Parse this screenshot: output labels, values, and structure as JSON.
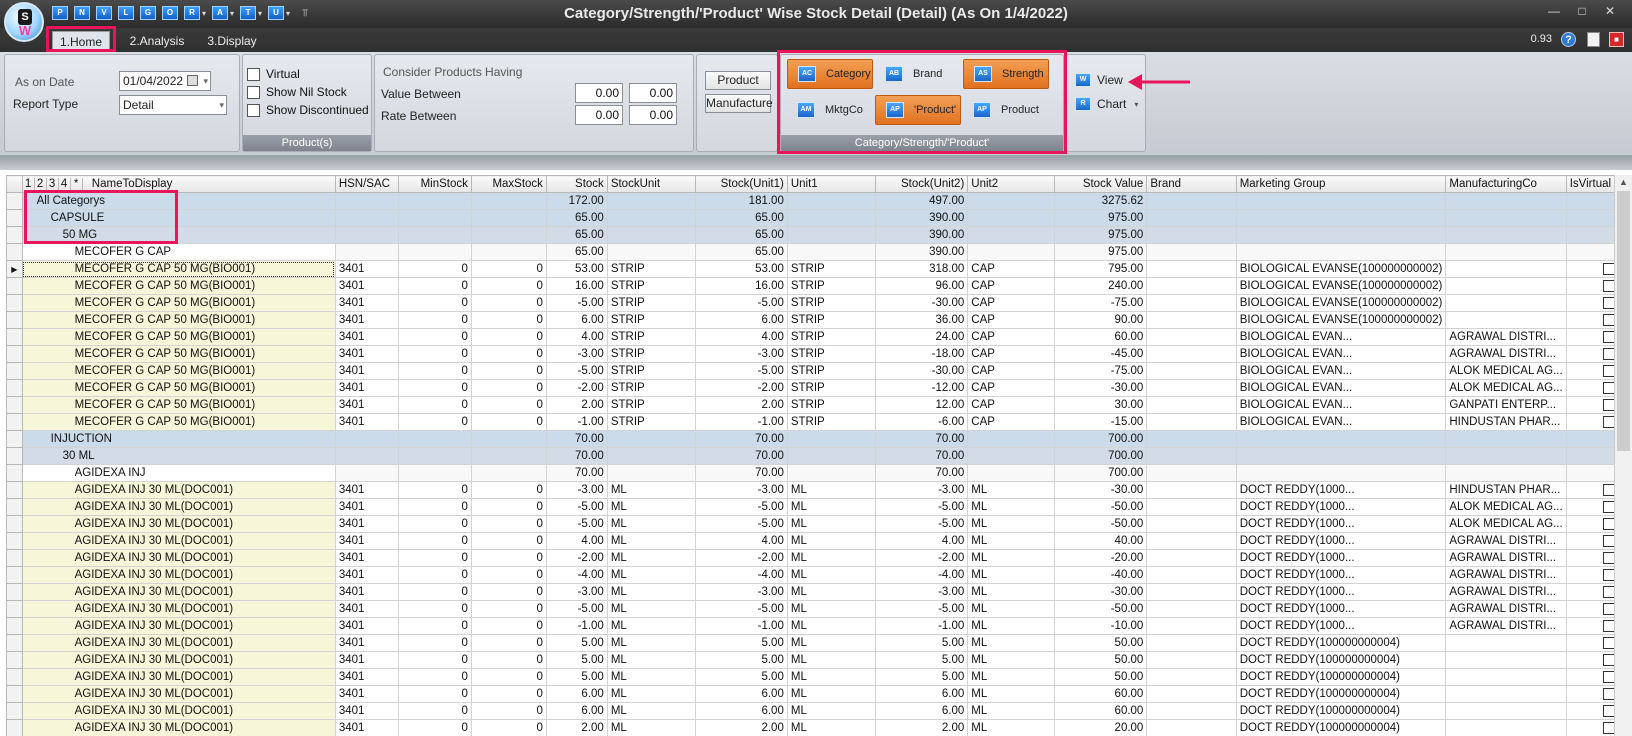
{
  "window": {
    "title": "Category/Strength/'Product' Wise Stock Detail (Detail)  (As On 1/4/2022)",
    "zoom": "0.93"
  },
  "quick_access": [
    {
      "icon": "P"
    },
    {
      "icon": "N"
    },
    {
      "icon": "V"
    },
    {
      "icon": "L"
    },
    {
      "icon": "G"
    },
    {
      "icon": "O"
    },
    {
      "icon": "R"
    },
    {
      "icon": "A"
    },
    {
      "icon": "T"
    },
    {
      "icon": "U"
    }
  ],
  "tabs": [
    {
      "label": "1.Home"
    },
    {
      "label": "2.Analysis"
    },
    {
      "label": "3.Display"
    }
  ],
  "params": {
    "as_on_label": "As on Date",
    "as_on_value": "01/04/2022",
    "report_type_label": "Report Type",
    "report_type_value": "Detail"
  },
  "product_group": {
    "caption": "Product(s)",
    "virtual": "Virtual",
    "show_nil": "Show Nil Stock",
    "show_discontinued": "Show Discontinued"
  },
  "consider": {
    "title": "Consider Products Having",
    "value_between": "Value Between",
    "rate_between": "Rate Between",
    "v1": "0.00",
    "v2": "0.00",
    "r1": "0.00",
    "r2": "0.00"
  },
  "pm": {
    "product": "Product",
    "manufacture": "Manufacture"
  },
  "cat_group": {
    "caption": "Category/Strength/'Product'",
    "category": "Category",
    "brand": "Brand",
    "strength": "Strength",
    "mktgco": "MktgCo",
    "product_quoted": "'Product'",
    "product": "Product"
  },
  "view_group": {
    "view": "View",
    "chart": "Chart"
  },
  "grid": {
    "levels": [
      "1",
      "2",
      "3",
      "4",
      "*"
    ],
    "columns": [
      "NameToDisplay",
      "HSN/SAC",
      "MinStock",
      "MaxStock",
      "Stock",
      "StockUnit",
      "Stock(Unit1)",
      "Unit1",
      "Stock(Unit2)",
      "Unit2",
      "Stock Value",
      "Brand",
      "Marketing Group",
      "ManufacturingCo",
      "IsVirtual"
    ],
    "rows": [
      {
        "lvl": "g0",
        "name": "All Categorys",
        "stock": "172.00",
        "s1": "181.00",
        "s2": "497.00",
        "val": "3275.62"
      },
      {
        "lvl": "g1",
        "name": "CAPSULE",
        "stock": "65.00",
        "s1": "65.00",
        "s2": "390.00",
        "val": "975.00"
      },
      {
        "lvl": "g2",
        "name": "50 MG",
        "stock": "65.00",
        "s1": "65.00",
        "s2": "390.00",
        "val": "975.00"
      },
      {
        "lvl": "g3",
        "name": "MECOFER G CAP",
        "stock": "65.00",
        "s1": "65.00",
        "s2": "390.00",
        "val": "975.00"
      },
      {
        "lvl": "d",
        "cur": true,
        "name": "MECOFER G CAP 50 MG(BIO001)",
        "hsn": "3401",
        "min": "0",
        "max": "0",
        "stock": "53.00",
        "su": "STRIP",
        "s1": "53.00",
        "u1": "STRIP",
        "s2": "318.00",
        "u2": "CAP",
        "val": "795.00",
        "mg": "BIOLOGICAL EVANSE(100000000002)",
        "mc": ""
      },
      {
        "lvl": "d",
        "name": "MECOFER G CAP 50 MG(BIO001)",
        "hsn": "3401",
        "min": "0",
        "max": "0",
        "stock": "16.00",
        "su": "STRIP",
        "s1": "16.00",
        "u1": "STRIP",
        "s2": "96.00",
        "u2": "CAP",
        "val": "240.00",
        "mg": "BIOLOGICAL EVANSE(100000000002)",
        "mc": ""
      },
      {
        "lvl": "d",
        "name": "MECOFER G CAP 50 MG(BIO001)",
        "hsn": "3401",
        "min": "0",
        "max": "0",
        "stock": "-5.00",
        "su": "STRIP",
        "s1": "-5.00",
        "u1": "STRIP",
        "s2": "-30.00",
        "u2": "CAP",
        "val": "-75.00",
        "mg": "BIOLOGICAL EVANSE(100000000002)",
        "mc": ""
      },
      {
        "lvl": "d",
        "name": "MECOFER G CAP 50 MG(BIO001)",
        "hsn": "3401",
        "min": "0",
        "max": "0",
        "stock": "6.00",
        "su": "STRIP",
        "s1": "6.00",
        "u1": "STRIP",
        "s2": "36.00",
        "u2": "CAP",
        "val": "90.00",
        "mg": "BIOLOGICAL EVANSE(100000000002)",
        "mc": ""
      },
      {
        "lvl": "d",
        "name": "MECOFER G CAP 50 MG(BIO001)",
        "hsn": "3401",
        "min": "0",
        "max": "0",
        "stock": "4.00",
        "su": "STRIP",
        "s1": "4.00",
        "u1": "STRIP",
        "s2": "24.00",
        "u2": "CAP",
        "val": "60.00",
        "mg": "BIOLOGICAL EVAN...",
        "mc": "AGRAWAL DISTRI..."
      },
      {
        "lvl": "d",
        "name": "MECOFER G CAP 50 MG(BIO001)",
        "hsn": "3401",
        "min": "0",
        "max": "0",
        "stock": "-3.00",
        "su": "STRIP",
        "s1": "-3.00",
        "u1": "STRIP",
        "s2": "-18.00",
        "u2": "CAP",
        "val": "-45.00",
        "mg": "BIOLOGICAL EVAN...",
        "mc": "AGRAWAL DISTRI..."
      },
      {
        "lvl": "d",
        "name": "MECOFER G CAP 50 MG(BIO001)",
        "hsn": "3401",
        "min": "0",
        "max": "0",
        "stock": "-5.00",
        "su": "STRIP",
        "s1": "-5.00",
        "u1": "STRIP",
        "s2": "-30.00",
        "u2": "CAP",
        "val": "-75.00",
        "mg": "BIOLOGICAL EVAN...",
        "mc": "ALOK MEDICAL AG..."
      },
      {
        "lvl": "d",
        "name": "MECOFER G CAP 50 MG(BIO001)",
        "hsn": "3401",
        "min": "0",
        "max": "0",
        "stock": "-2.00",
        "su": "STRIP",
        "s1": "-2.00",
        "u1": "STRIP",
        "s2": "-12.00",
        "u2": "CAP",
        "val": "-30.00",
        "mg": "BIOLOGICAL EVAN...",
        "mc": "ALOK MEDICAL AG..."
      },
      {
        "lvl": "d",
        "name": "MECOFER G CAP 50 MG(BIO001)",
        "hsn": "3401",
        "min": "0",
        "max": "0",
        "stock": "2.00",
        "su": "STRIP",
        "s1": "2.00",
        "u1": "STRIP",
        "s2": "12.00",
        "u2": "CAP",
        "val": "30.00",
        "mg": "BIOLOGICAL EVAN...",
        "mc": "GANPATI ENTERP..."
      },
      {
        "lvl": "d",
        "name": "MECOFER G CAP 50 MG(BIO001)",
        "hsn": "3401",
        "min": "0",
        "max": "0",
        "stock": "-1.00",
        "su": "STRIP",
        "s1": "-1.00",
        "u1": "STRIP",
        "s2": "-6.00",
        "u2": "CAP",
        "val": "-15.00",
        "mg": "BIOLOGICAL EVAN...",
        "mc": "HINDUSTAN PHAR..."
      },
      {
        "lvl": "g1",
        "name": "INJUCTION",
        "stock": "70.00",
        "s1": "70.00",
        "s2": "70.00",
        "val": "700.00"
      },
      {
        "lvl": "g2",
        "name": "30 ML",
        "stock": "70.00",
        "s1": "70.00",
        "s2": "70.00",
        "val": "700.00"
      },
      {
        "lvl": "g3",
        "name": "AGIDEXA INJ",
        "stock": "70.00",
        "s1": "70.00",
        "s2": "70.00",
        "val": "700.00"
      },
      {
        "lvl": "d",
        "name": "AGIDEXA INJ 30 ML(DOC001)",
        "hsn": "3401",
        "min": "0",
        "max": "0",
        "stock": "-3.00",
        "su": "ML",
        "s1": "-3.00",
        "u1": "ML",
        "s2": "-3.00",
        "u2": "ML",
        "val": "-30.00",
        "mg": "DOCT REDDY(1000...",
        "mc": "HINDUSTAN PHAR..."
      },
      {
        "lvl": "d",
        "name": "AGIDEXA INJ 30 ML(DOC001)",
        "hsn": "3401",
        "min": "0",
        "max": "0",
        "stock": "-5.00",
        "su": "ML",
        "s1": "-5.00",
        "u1": "ML",
        "s2": "-5.00",
        "u2": "ML",
        "val": "-50.00",
        "mg": "DOCT REDDY(1000...",
        "mc": "ALOK MEDICAL AG..."
      },
      {
        "lvl": "d",
        "name": "AGIDEXA INJ 30 ML(DOC001)",
        "hsn": "3401",
        "min": "0",
        "max": "0",
        "stock": "-5.00",
        "su": "ML",
        "s1": "-5.00",
        "u1": "ML",
        "s2": "-5.00",
        "u2": "ML",
        "val": "-50.00",
        "mg": "DOCT REDDY(1000...",
        "mc": "ALOK MEDICAL AG..."
      },
      {
        "lvl": "d",
        "name": "AGIDEXA INJ 30 ML(DOC001)",
        "hsn": "3401",
        "min": "0",
        "max": "0",
        "stock": "4.00",
        "su": "ML",
        "s1": "4.00",
        "u1": "ML",
        "s2": "4.00",
        "u2": "ML",
        "val": "40.00",
        "mg": "DOCT REDDY(1000...",
        "mc": "AGRAWAL DISTRI..."
      },
      {
        "lvl": "d",
        "name": "AGIDEXA INJ 30 ML(DOC001)",
        "hsn": "3401",
        "min": "0",
        "max": "0",
        "stock": "-2.00",
        "su": "ML",
        "s1": "-2.00",
        "u1": "ML",
        "s2": "-2.00",
        "u2": "ML",
        "val": "-20.00",
        "mg": "DOCT REDDY(1000...",
        "mc": "AGRAWAL DISTRI..."
      },
      {
        "lvl": "d",
        "name": "AGIDEXA INJ 30 ML(DOC001)",
        "hsn": "3401",
        "min": "0",
        "max": "0",
        "stock": "-4.00",
        "su": "ML",
        "s1": "-4.00",
        "u1": "ML",
        "s2": "-4.00",
        "u2": "ML",
        "val": "-40.00",
        "mg": "DOCT REDDY(1000...",
        "mc": "AGRAWAL DISTRI..."
      },
      {
        "lvl": "d",
        "name": "AGIDEXA INJ 30 ML(DOC001)",
        "hsn": "3401",
        "min": "0",
        "max": "0",
        "stock": "-3.00",
        "su": "ML",
        "s1": "-3.00",
        "u1": "ML",
        "s2": "-3.00",
        "u2": "ML",
        "val": "-30.00",
        "mg": "DOCT REDDY(1000...",
        "mc": "AGRAWAL DISTRI..."
      },
      {
        "lvl": "d",
        "name": "AGIDEXA INJ 30 ML(DOC001)",
        "hsn": "3401",
        "min": "0",
        "max": "0",
        "stock": "-5.00",
        "su": "ML",
        "s1": "-5.00",
        "u1": "ML",
        "s2": "-5.00",
        "u2": "ML",
        "val": "-50.00",
        "mg": "DOCT REDDY(1000...",
        "mc": "AGRAWAL DISTRI..."
      },
      {
        "lvl": "d",
        "name": "AGIDEXA INJ 30 ML(DOC001)",
        "hsn": "3401",
        "min": "0",
        "max": "0",
        "stock": "-1.00",
        "su": "ML",
        "s1": "-1.00",
        "u1": "ML",
        "s2": "-1.00",
        "u2": "ML",
        "val": "-10.00",
        "mg": "DOCT REDDY(1000...",
        "mc": "AGRAWAL DISTRI..."
      },
      {
        "lvl": "d",
        "name": "AGIDEXA INJ 30 ML(DOC001)",
        "hsn": "3401",
        "min": "0",
        "max": "0",
        "stock": "5.00",
        "su": "ML",
        "s1": "5.00",
        "u1": "ML",
        "s2": "5.00",
        "u2": "ML",
        "val": "50.00",
        "mg": "DOCT REDDY(100000000004)",
        "mc": ""
      },
      {
        "lvl": "d",
        "name": "AGIDEXA INJ 30 ML(DOC001)",
        "hsn": "3401",
        "min": "0",
        "max": "0",
        "stock": "5.00",
        "su": "ML",
        "s1": "5.00",
        "u1": "ML",
        "s2": "5.00",
        "u2": "ML",
        "val": "50.00",
        "mg": "DOCT REDDY(100000000004)",
        "mc": ""
      },
      {
        "lvl": "d",
        "name": "AGIDEXA INJ 30 ML(DOC001)",
        "hsn": "3401",
        "min": "0",
        "max": "0",
        "stock": "5.00",
        "su": "ML",
        "s1": "5.00",
        "u1": "ML",
        "s2": "5.00",
        "u2": "ML",
        "val": "50.00",
        "mg": "DOCT REDDY(100000000004)",
        "mc": ""
      },
      {
        "lvl": "d",
        "name": "AGIDEXA INJ 30 ML(DOC001)",
        "hsn": "3401",
        "min": "0",
        "max": "0",
        "stock": "6.00",
        "su": "ML",
        "s1": "6.00",
        "u1": "ML",
        "s2": "6.00",
        "u2": "ML",
        "val": "60.00",
        "mg": "DOCT REDDY(100000000004)",
        "mc": ""
      },
      {
        "lvl": "d",
        "name": "AGIDEXA INJ 30 ML(DOC001)",
        "hsn": "3401",
        "min": "0",
        "max": "0",
        "stock": "6.00",
        "su": "ML",
        "s1": "6.00",
        "u1": "ML",
        "s2": "6.00",
        "u2": "ML",
        "val": "60.00",
        "mg": "DOCT REDDY(100000000004)",
        "mc": ""
      },
      {
        "lvl": "d",
        "name": "AGIDEXA INJ 30 ML(DOC001)",
        "hsn": "3401",
        "min": "0",
        "max": "0",
        "stock": "2.00",
        "su": "ML",
        "s1": "2.00",
        "u1": "ML",
        "s2": "2.00",
        "u2": "ML",
        "val": "20.00",
        "mg": "DOCT REDDY(100000000004)",
        "mc": ""
      }
    ]
  },
  "colors": {
    "highlight": "#e8155b",
    "active_button": "#e07120"
  }
}
